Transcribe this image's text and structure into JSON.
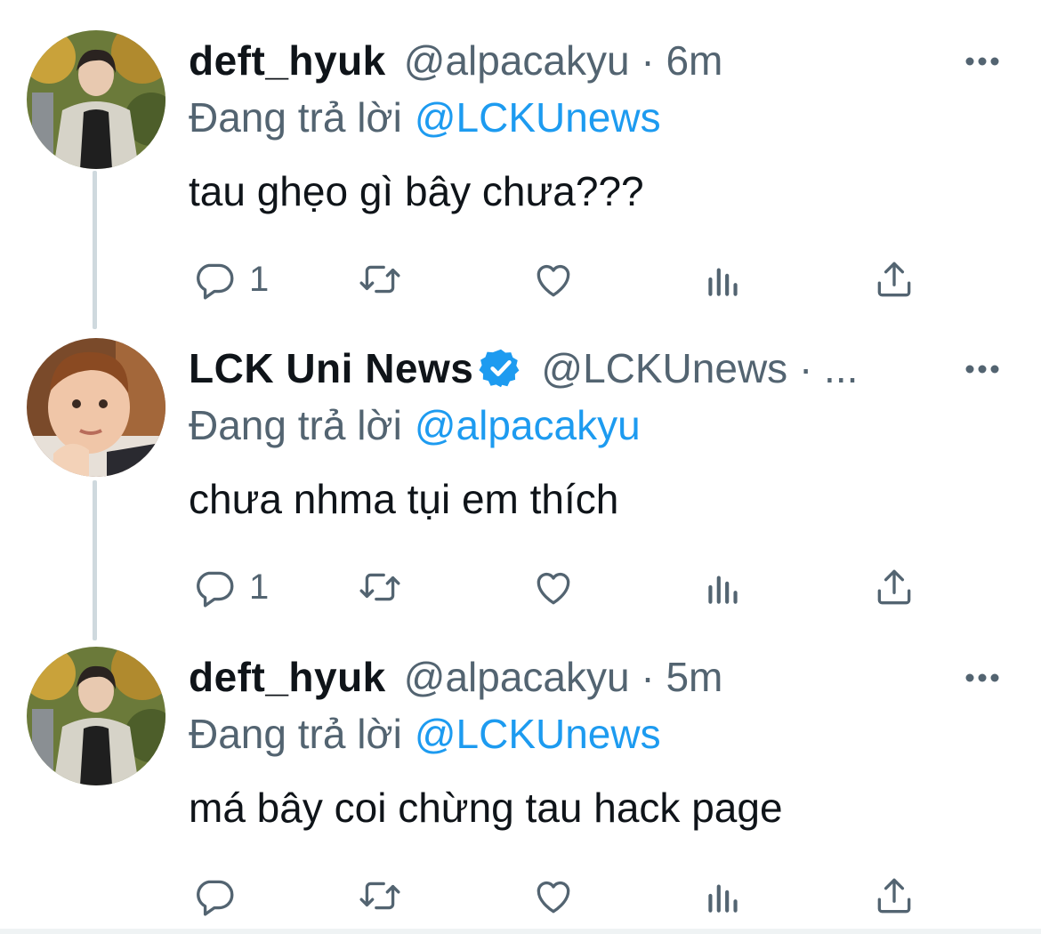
{
  "tweets": [
    {
      "display_name": "deft_hyuk",
      "handle_meta": "@alpacakyu · 6m",
      "verified": false,
      "reply_prefix": "Đang trả lời",
      "reply_to": "@LCKUnews",
      "text": "tau ghẹo gì bây chưa???",
      "reply_count": "1",
      "avatar": "person-avatar-1"
    },
    {
      "display_name": "LCK Uni News",
      "handle_meta": "@LCKUnews · ...",
      "verified": true,
      "reply_prefix": "Đang trả lời",
      "reply_to": "@alpacakyu",
      "text": "chưa nhma tụi em thích",
      "reply_count": "1",
      "avatar": "child-avatar"
    },
    {
      "display_name": "deft_hyuk",
      "handle_meta": "@alpacakyu · 5m",
      "verified": false,
      "reply_prefix": "Đang trả lời",
      "reply_to": "@LCKUnews",
      "text": "má bây coi chừng tau hack page",
      "reply_count": "",
      "avatar": "person-avatar-1"
    }
  ],
  "icons": {
    "reply": "reply-icon",
    "retweet": "retweet-icon",
    "like": "like-icon",
    "analytics": "analytics-icon",
    "share": "share-icon",
    "more": "more-icon",
    "verified": "verified-badge-icon"
  },
  "colors": {
    "text": "#0f1419",
    "secondary": "#536471",
    "accent": "#1d9bf0",
    "thread_line": "#cfd9de"
  }
}
